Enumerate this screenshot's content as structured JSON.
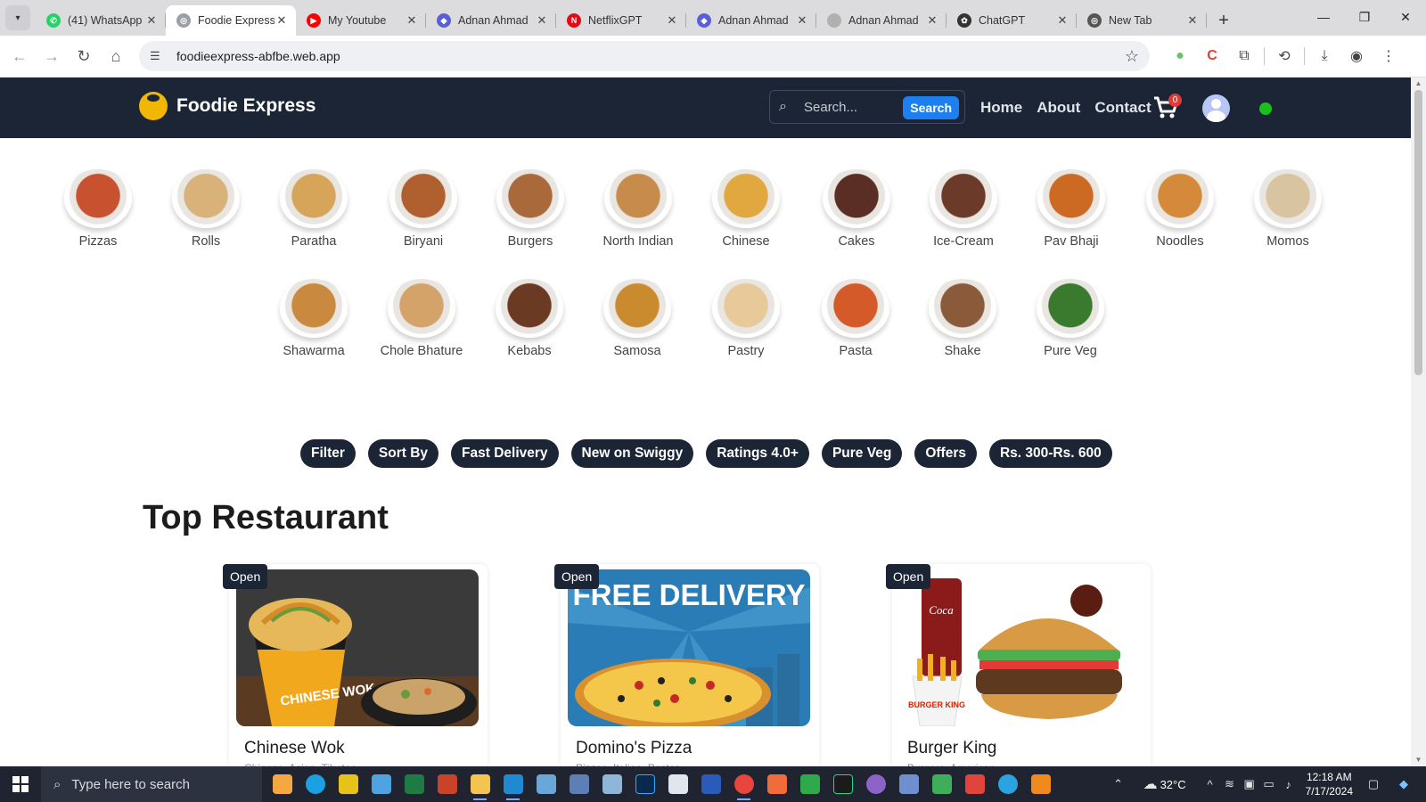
{
  "browser": {
    "tabs": [
      {
        "title": "(41) WhatsApp",
        "icon": "whatsapp-icon",
        "color": "#25d366",
        "active": false
      },
      {
        "title": "Foodie Express",
        "icon": "globe-icon",
        "color": "#9aa0a6",
        "active": true
      },
      {
        "title": "My Youtube",
        "icon": "youtube-icon",
        "color": "#ff0000",
        "active": false
      },
      {
        "title": "Adnan Ahmad",
        "icon": "gradient-icon",
        "color": "#5b5fd6",
        "active": false
      },
      {
        "title": "NetflixGPT",
        "icon": "netflix-icon",
        "color": "#e50914",
        "active": false
      },
      {
        "title": "Adnan Ahmad",
        "icon": "gradient-icon",
        "color": "#5b5fd6",
        "active": false
      },
      {
        "title": "Adnan Ahmad",
        "icon": "grey-circle-icon",
        "color": "#b0b0b0",
        "active": false
      },
      {
        "title": "ChatGPT",
        "icon": "chatgpt-icon",
        "color": "#333333",
        "active": false
      },
      {
        "title": "New Tab",
        "icon": "chrome-icon",
        "color": "#555555",
        "active": false
      }
    ],
    "url": "foodieexpress-abfbe.web.app"
  },
  "site": {
    "brand": "Foodie Express",
    "search_placeholder": "Search...",
    "search_button": "Search",
    "nav": {
      "home": "Home",
      "about": "About",
      "contact": "Contact"
    },
    "cart_count": "0",
    "status_color": "#18c21a"
  },
  "categories": [
    {
      "label": "Pizzas",
      "color": "#c8512f"
    },
    {
      "label": "Rolls",
      "color": "#d9b27a"
    },
    {
      "label": "Paratha",
      "color": "#d6a55a"
    },
    {
      "label": "Biryani",
      "color": "#b0602e"
    },
    {
      "label": "Burgers",
      "color": "#a9693a"
    },
    {
      "label": "North Indian",
      "color": "#c78c4c"
    },
    {
      "label": "Chinese",
      "color": "#e1a83f"
    },
    {
      "label": "Cakes",
      "color": "#5a2e24"
    },
    {
      "label": "Ice-Cream",
      "color": "#6b3a28"
    },
    {
      "label": "Pav Bhaji",
      "color": "#cc6a24"
    },
    {
      "label": "Noodles",
      "color": "#d48a3a"
    },
    {
      "label": "Momos",
      "color": "#d8c4a0"
    },
    {
      "label": "Shawarma",
      "color": "#c9893f"
    },
    {
      "label": "Chole Bhature",
      "color": "#d3a36a"
    },
    {
      "label": "Kebabs",
      "color": "#6b3a22"
    },
    {
      "label": "Samosa",
      "color": "#c98b2e"
    },
    {
      "label": "Pastry",
      "color": "#e7c99a"
    },
    {
      "label": "Pasta",
      "color": "#d45a2a"
    },
    {
      "label": "Shake",
      "color": "#8a5a3a"
    },
    {
      "label": "Pure Veg",
      "color": "#3a7a2e"
    }
  ],
  "filters": [
    "Filter",
    "Sort By",
    "Fast Delivery",
    "New on Swiggy",
    "Ratings 4.0+",
    "Pure Veg",
    "Offers",
    "Rs. 300-Rs. 600"
  ],
  "section_title": "Top Restaurant",
  "restaurants": [
    {
      "name": "Chinese Wok",
      "cuisine": "Chinese, Asian, Tibetan",
      "status": "Open",
      "photo_text": "CHINESE WOK"
    },
    {
      "name": "Domino's Pizza",
      "cuisine": "Pizzas, Italian, Pastas",
      "status": "Open",
      "photo_text": "FREE DELIVERY"
    },
    {
      "name": "Burger King",
      "cuisine": "Burgers, American",
      "status": "Open",
      "photo_text": "BURGER KING"
    }
  ],
  "taskbar": {
    "search_placeholder": "Type here to search",
    "temperature": "32°C",
    "time": "12:18 AM",
    "date": "7/17/2024"
  }
}
